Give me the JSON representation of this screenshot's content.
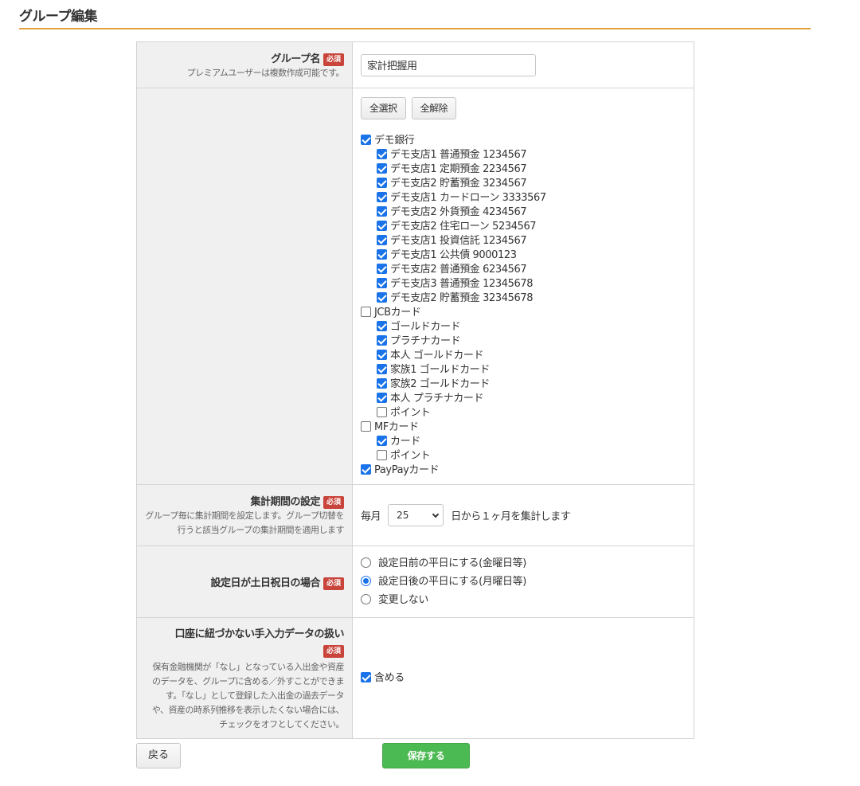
{
  "page": {
    "title": "グループ編集"
  },
  "group_name": {
    "label": "グループ名",
    "required": "必須",
    "note": "プレミアムユーザーは複数作成可能です。",
    "value": "家計把握用"
  },
  "accounts": {
    "select_all": "全選択",
    "deselect_all": "全解除",
    "institutions": [
      {
        "name": "デモ銀行",
        "checked": true,
        "items": [
          {
            "name": "デモ支店1 普通預金 1234567",
            "checked": true
          },
          {
            "name": "デモ支店1 定期預金 2234567",
            "checked": true
          },
          {
            "name": "デモ支店2 貯蓄預金 3234567",
            "checked": true
          },
          {
            "name": "デモ支店1 カードローン 3333567",
            "checked": true
          },
          {
            "name": "デモ支店2 外貨預金 4234567",
            "checked": true
          },
          {
            "name": "デモ支店2 住宅ローン 5234567",
            "checked": true
          },
          {
            "name": "デモ支店1 投資信託 1234567",
            "checked": true
          },
          {
            "name": "デモ支店1 公共債 9000123",
            "checked": true
          },
          {
            "name": "デモ支店2 普通預金 6234567",
            "checked": true
          },
          {
            "name": "デモ支店3 普通預金 12345678",
            "checked": true
          },
          {
            "name": "デモ支店2 貯蓄預金 32345678",
            "checked": true
          }
        ]
      },
      {
        "name": "JCBカード",
        "checked": false,
        "items": [
          {
            "name": "ゴールドカード",
            "checked": true
          },
          {
            "name": "プラチナカード",
            "checked": true
          },
          {
            "name": "本人 ゴールドカード",
            "checked": true
          },
          {
            "name": "家族1 ゴールドカード",
            "checked": true
          },
          {
            "name": "家族2 ゴールドカード",
            "checked": true
          },
          {
            "name": "本人 プラチナカード",
            "checked": true
          },
          {
            "name": "ポイント",
            "checked": false
          }
        ]
      },
      {
        "name": "MFカード",
        "checked": false,
        "items": [
          {
            "name": "カード",
            "checked": true
          },
          {
            "name": "ポイント",
            "checked": false
          }
        ]
      },
      {
        "name": "PayPayカード",
        "checked": true,
        "items": []
      }
    ]
  },
  "period": {
    "label": "集計期間の設定",
    "required": "必須",
    "note": "グループ毎に集計期間を設定します。グループ切替を行うと該当グループの集計期間を適用します",
    "prefix": "毎月",
    "day_value": "25",
    "suffix": "日から１ヶ月を集計します"
  },
  "holiday": {
    "label": "設定日が土日祝日の場合",
    "required": "必須",
    "options": [
      {
        "label": "設定日前の平日にする(金曜日等)",
        "selected": false
      },
      {
        "label": "設定日後の平日にする(月曜日等)",
        "selected": true
      },
      {
        "label": "変更しない",
        "selected": false
      }
    ]
  },
  "manual_data": {
    "label": "口座に紐づかない手入力データの扱い",
    "required": "必須",
    "note": "保有金融機関が「なし」となっている入出金や資産のデータを、グループに含める／外すことができます。「なし」として登録した入出金の過去データや、資産の時系列推移を表示したくない場合には、チェックをオフとしてください。",
    "include_label": "含める",
    "include_checked": true
  },
  "footer": {
    "back_label": "戻る",
    "save_label": "保存する"
  },
  "colors": {
    "accent_rule": "#e0a040",
    "required_badge": "#c9453b",
    "save_button": "#4cba52",
    "checkbox": "#1a73e8"
  }
}
